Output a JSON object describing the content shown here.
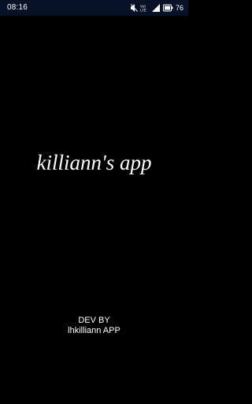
{
  "status_bar": {
    "time": "08:16",
    "signal_label": "Vo) LTE",
    "battery_percent": "76",
    "icons": [
      "mute-icon",
      "volte-icon",
      "lte-signal-icon",
      "battery-icon"
    ]
  },
  "splash": {
    "title": "killiann's app",
    "dev_by_label": "DEV BY",
    "dev_name": "lhkilliann APP"
  },
  "colors": {
    "background": "#000000",
    "status_bar": "#071128",
    "text": "#ffffff"
  }
}
